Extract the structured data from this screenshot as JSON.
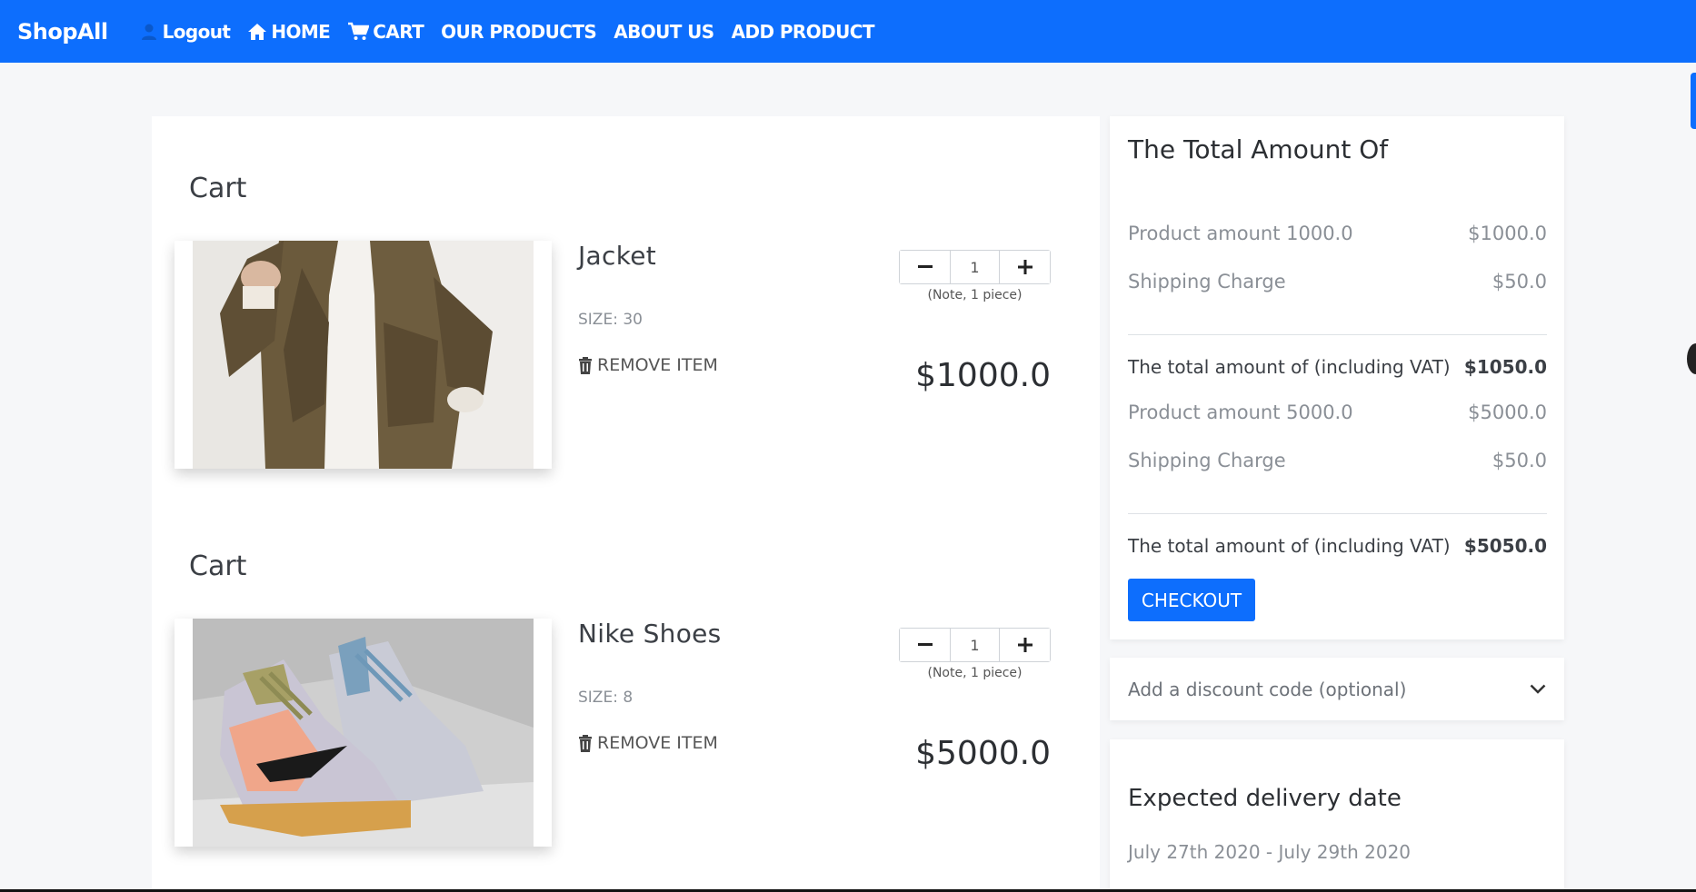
{
  "navbar": {
    "brand": "ShopAll",
    "items": [
      {
        "label": "Logout",
        "icon": "user-icon"
      },
      {
        "label": "HOME",
        "icon": "home-icon"
      },
      {
        "label": "CART",
        "icon": "cart-icon"
      },
      {
        "label": "OUR PRODUCTS"
      },
      {
        "label": "ABOUT US"
      },
      {
        "label": "ADD PRODUCT"
      }
    ]
  },
  "cart_items": [
    {
      "heading": "Cart",
      "name": "Jacket",
      "size": "SIZE: 30",
      "remove_label": "REMOVE ITEM",
      "quantity": "1",
      "note": "(Note, 1 piece)",
      "price": "$1000.0",
      "image": "jacket-photo"
    },
    {
      "heading": "Cart",
      "name": "Nike Shoes",
      "size": "SIZE: 8",
      "remove_label": "REMOVE ITEM",
      "quantity": "1",
      "note": "(Note, 1 piece)",
      "price": "$5000.0",
      "image": "sneakers-photo"
    }
  ],
  "summary": {
    "title": "The Total Amount Of",
    "groups": [
      {
        "product_label": "Product amount 1000.0",
        "product_value": "$1000.0",
        "shipping_label": "Shipping Charge",
        "shipping_value": "$50.0",
        "total_label": "The total amount of (including VAT)",
        "total_value": "$1050.0"
      },
      {
        "product_label": "Product amount 5000.0",
        "product_value": "$5000.0",
        "shipping_label": "Shipping Charge",
        "shipping_value": "$50.0",
        "total_label": "The total amount of (including VAT)",
        "total_value": "$5050.0"
      }
    ],
    "checkout_label": "CHECKOUT"
  },
  "discount": {
    "label": "Add a discount code (optional)"
  },
  "delivery": {
    "title": "Expected delivery date",
    "dates": "July 27th 2020 - July 29th 2020"
  },
  "colors": {
    "accent": "#0d6efd",
    "background": "#f6f7f9"
  }
}
